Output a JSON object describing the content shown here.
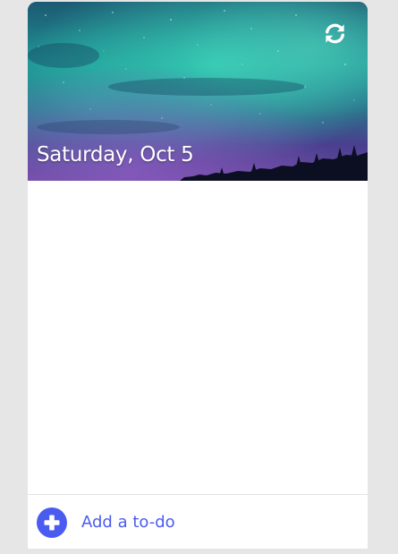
{
  "header": {
    "date_label": "Saturday, Oct 5",
    "refresh_icon": "refresh-icon"
  },
  "todo_list": {
    "items": []
  },
  "footer": {
    "add_label": "Add a to-do",
    "add_icon": "plus-icon"
  },
  "colors": {
    "accent": "#4a5cf0",
    "page_background": "#e6e6e6",
    "card_background": "#ffffff"
  }
}
